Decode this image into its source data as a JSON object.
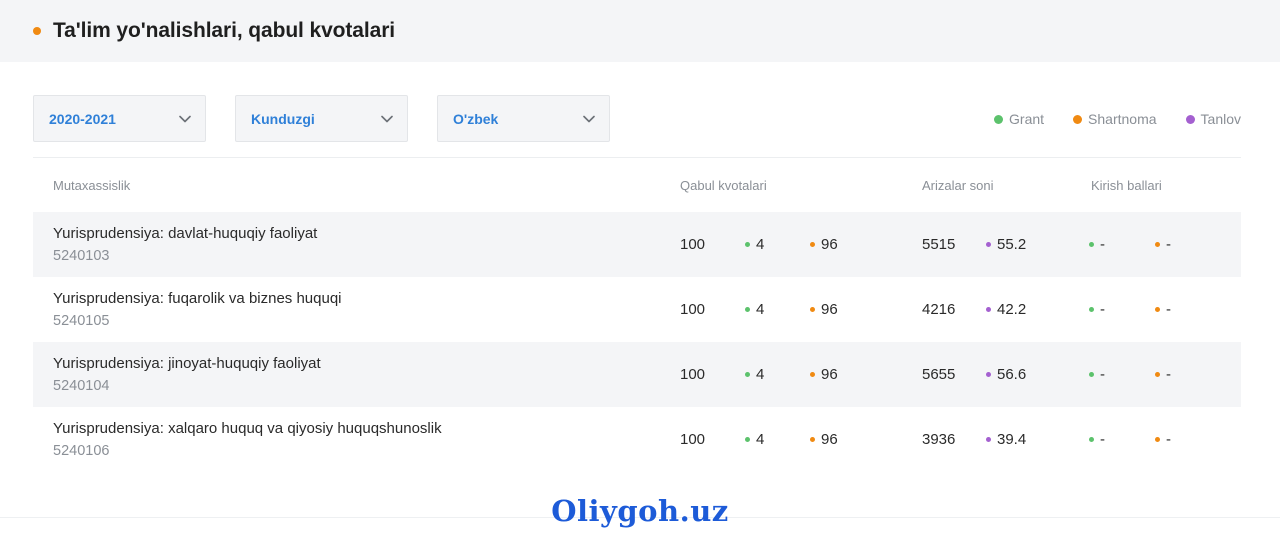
{
  "header": {
    "title": "Ta'lim yo'nalishlari, qabul kvotalari"
  },
  "filters": [
    {
      "value": "2020-2021"
    },
    {
      "value": "Kunduzgi"
    },
    {
      "value": "O'zbek"
    }
  ],
  "legend": [
    {
      "label": "Grant",
      "color": "#5cc26c"
    },
    {
      "label": "Shartnoma",
      "color": "#f08a12"
    },
    {
      "label": "Tanlov",
      "color": "#a460d0"
    }
  ],
  "columns": {
    "specialty": "Mutaxassislik",
    "quotas": "Qabul kvotalari",
    "applications": "Arizalar soni",
    "scores": "Kirish ballari"
  },
  "rows": [
    {
      "name": "Yurisprudensiya: davlat-huquqiy faoliyat",
      "code": "5240103",
      "total": "100",
      "grant": "4",
      "contract": "96",
      "applications": "5515",
      "ratio": "55.2",
      "score_grant": "-",
      "score_contract": "-"
    },
    {
      "name": "Yurisprudensiya: fuqarolik va biznes huquqi",
      "code": "5240105",
      "total": "100",
      "grant": "4",
      "contract": "96",
      "applications": "4216",
      "ratio": "42.2",
      "score_grant": "-",
      "score_contract": "-"
    },
    {
      "name": "Yurisprudensiya: jinoyat-huquqiy faoliyat",
      "code": "5240104",
      "total": "100",
      "grant": "4",
      "contract": "96",
      "applications": "5655",
      "ratio": "56.6",
      "score_grant": "-",
      "score_contract": "-"
    },
    {
      "name": "Yurisprudensiya: xalqaro huquq va qiyosiy huquqshunoslik",
      "code": "5240106",
      "total": "100",
      "grant": "4",
      "contract": "96",
      "applications": "3936",
      "ratio": "39.4",
      "score_grant": "-",
      "score_contract": "-"
    }
  ],
  "watermark": "Oliygoh.uz"
}
